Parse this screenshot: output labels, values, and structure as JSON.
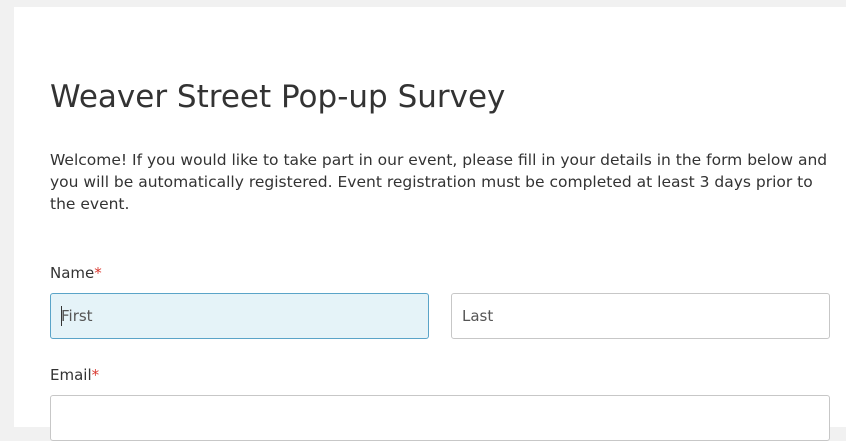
{
  "form": {
    "title": "Weaver Street Pop-up Survey",
    "intro": "Welcome! If you would like to take part in our event, please fill in your details in the form below and you will be automatically registered. Event registration must be completed at least 3 days prior to the event.",
    "required_marker": "*",
    "fields": {
      "name": {
        "label": "Name",
        "first_placeholder": "First",
        "last_placeholder": "Last"
      },
      "email": {
        "label": "Email",
        "placeholder": ""
      }
    },
    "colors": {
      "required": "#d9382f",
      "focus_border": "#5aa4c8",
      "focus_background": "#e5f3f8"
    }
  }
}
